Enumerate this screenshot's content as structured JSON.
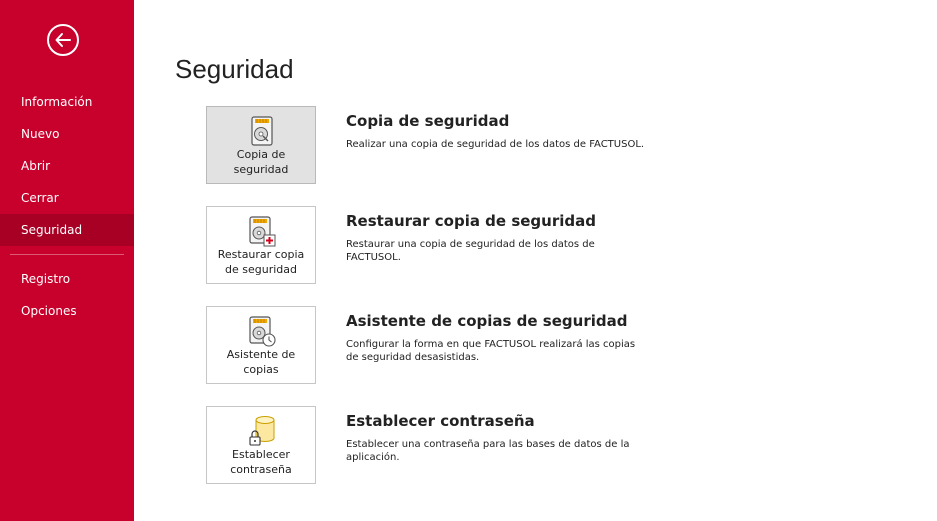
{
  "sidebar": {
    "back_icon": "arrow-left-circle-icon",
    "items": [
      {
        "label": "Información"
      },
      {
        "label": "Nuevo"
      },
      {
        "label": "Abrir"
      },
      {
        "label": "Cerrar"
      },
      {
        "label": "Seguridad",
        "active": true
      },
      {
        "label": "Registro"
      },
      {
        "label": "Opciones"
      }
    ]
  },
  "main": {
    "title": "Seguridad",
    "options": [
      {
        "tile_label": "Copia de\nseguridad",
        "icon": "backup-disk-icon",
        "title": "Copia de seguridad",
        "description": "Realizar una copia de seguridad de los datos de FACTUSOL."
      },
      {
        "tile_label": "Restaurar copia\nde seguridad",
        "icon": "restore-backup-icon",
        "title": "Restaurar copia de seguridad",
        "description": "Restaurar una copia de seguridad de los datos de FACTUSOL."
      },
      {
        "tile_label": "Asistente de\ncopias",
        "icon": "backup-wizard-clock-icon",
        "title": "Asistente de copias de seguridad",
        "description": "Configurar la forma en que FACTUSOL realizará las copias de seguridad desasistidas."
      },
      {
        "tile_label": "Establecer\ncontraseña",
        "icon": "database-lock-icon",
        "title": "Establecer contraseña",
        "description": "Establecer una contraseña para las bases de datos de la aplicación."
      }
    ]
  },
  "colors": {
    "sidebar_bg": "#c8002c",
    "sidebar_active": "#a80025",
    "tile_selected": "#e2e2e2"
  }
}
